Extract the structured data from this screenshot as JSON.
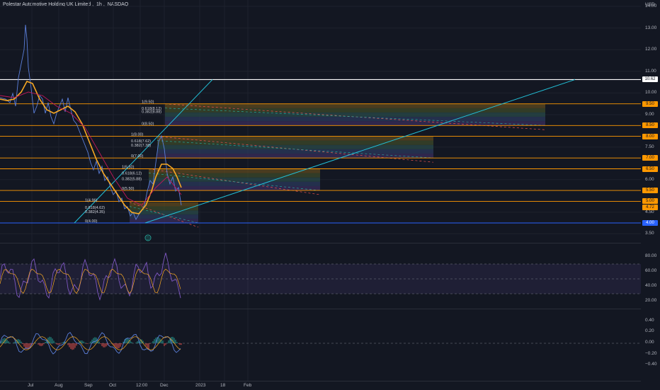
{
  "header": {
    "symbol_name": "Polestar Automotive Holding UK Limited",
    "interval": "1h",
    "exchange": "NASDAQ",
    "currency": "USD"
  },
  "price_axis": {
    "labels": [
      "14.00",
      "13.00",
      "12.00",
      "11.00",
      "10.00",
      "9.00",
      "8.00",
      "7.50",
      "7.00",
      "6.50",
      "6.00",
      "5.50",
      "5.00",
      "4.50",
      "4.00",
      "3.50"
    ],
    "tags": [
      {
        "text": "10.62",
        "color": "#ffffff",
        "value": 10.62
      },
      {
        "text": "9.50",
        "color": "#ff9800",
        "value": 9.5
      },
      {
        "text": "8.50",
        "color": "#ff9800",
        "value": 8.5
      },
      {
        "text": "8.00",
        "color": "#ff9800",
        "value": 8.0
      },
      {
        "text": "7.00",
        "color": "#ff9800",
        "value": 7.0
      },
      {
        "text": "6.50",
        "color": "#ff9800",
        "value": 6.5
      },
      {
        "text": "5.50",
        "color": "#ff9800",
        "value": 5.5
      },
      {
        "text": "5.00",
        "color": "#ff9800",
        "value": 5.0
      },
      {
        "text": "4.72",
        "color": "#ff9800",
        "value": 4.72
      },
      {
        "text": "4.00",
        "color": "#2962ff",
        "value": 4.0
      }
    ]
  },
  "rsi_axis": {
    "labels": [
      "80.00",
      "60.00",
      "40.00",
      "20.00"
    ]
  },
  "osc_axis": {
    "labels": [
      "0.40",
      "0.20",
      "0.00",
      "−0.20",
      "−0.40"
    ]
  },
  "time_axis": {
    "labels": [
      "Jul",
      "Aug",
      "Sep",
      "Oct",
      "12:00",
      "Dec",
      "2023",
      "18",
      "Feb"
    ]
  },
  "fib_labels": [
    {
      "text": "1(9.50)",
      "value": 9.5
    },
    {
      "text": "0.618(8.12)",
      "value": 9.2
    },
    {
      "text": "0.382(8.88)",
      "value": 9.05
    },
    {
      "text": "0(8.50)",
      "value": 8.5
    },
    {
      "text": "1(8.00)",
      "value": 8.0
    },
    {
      "text": "0.618(7.62)",
      "value": 7.7
    },
    {
      "text": "0.382(7.38)",
      "value": 7.5
    },
    {
      "text": "0(7.00)",
      "value": 7.0
    },
    {
      "text": "1(6.50)",
      "value": 6.5
    },
    {
      "text": "0.618(6.12)",
      "value": 6.2
    },
    {
      "text": "0.382(5.88)",
      "value": 5.95
    },
    {
      "text": "0(5.50)",
      "value": 5.5
    },
    {
      "text": "1(4.96)",
      "value": 4.96
    },
    {
      "text": "0.618(4.62)",
      "value": 4.62
    },
    {
      "text": "0.382(4.35)",
      "value": 4.42
    },
    {
      "text": "0(4.00)",
      "value": 4.0
    }
  ],
  "event_marker": "D",
  "colors": {
    "background": "#131722",
    "grid": "#1e222d",
    "level": "#ff9800",
    "support": "#2962ff",
    "trend": "#22c1d8",
    "price": "#5b7fdb",
    "ma": "#f7a823",
    "ma_slow": "#c2185b",
    "rsi_band": "#7e57c2"
  }
}
